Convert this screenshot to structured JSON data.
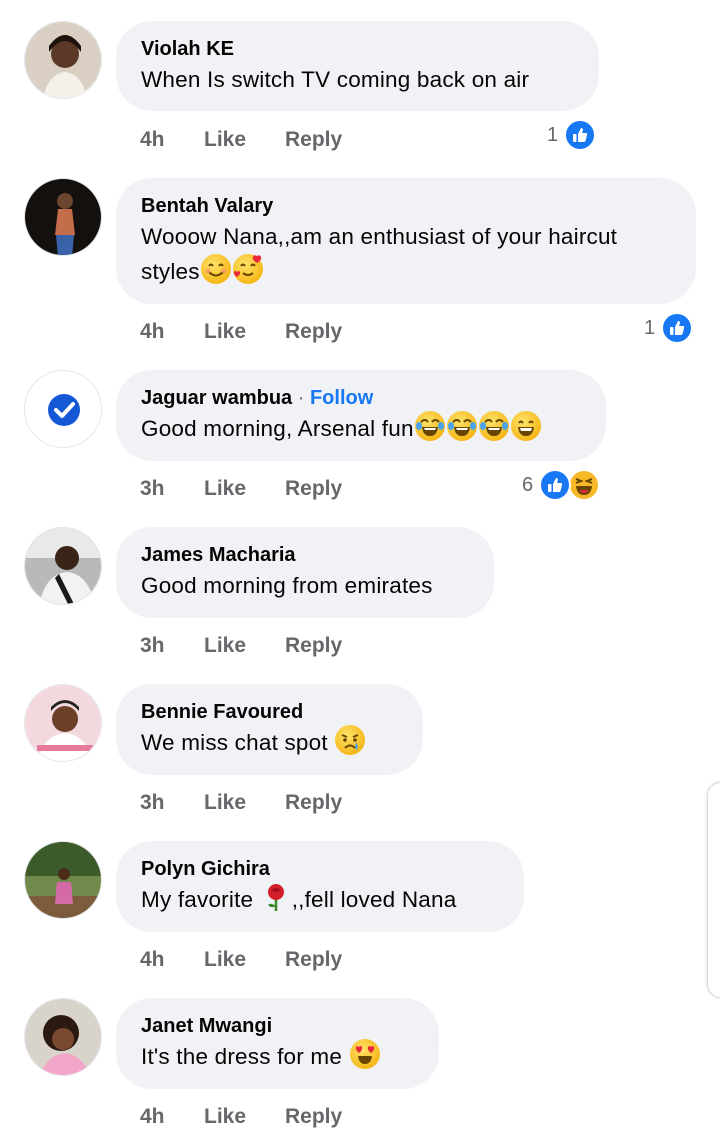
{
  "comments": [
    {
      "name": "Violah KE",
      "text": "When Is switch TV coming back on air",
      "time": "4h",
      "like": "Like",
      "reply": "Reply",
      "reaction_count": "1",
      "reactions": [
        "like-icon"
      ]
    },
    {
      "name": "Bentah Valary",
      "text_line1": "Wooow Nana,,am an enthusiast of your haircut",
      "text_line2": "styles",
      "time": "4h",
      "like": "Like",
      "reply": "Reply",
      "reaction_count": "1",
      "reactions": [
        "like-icon"
      ],
      "emojis": [
        "smiling-face-emoji",
        "smiling-face-with-hearts-emoji"
      ]
    },
    {
      "name": "Jaguar wambua",
      "separator": "·",
      "follow": "Follow",
      "text": "Good morning, Arsenal fun",
      "time": "3h",
      "like": "Like",
      "reply": "Reply",
      "reaction_count": "6",
      "reactions": [
        "like-icon",
        "haha-icon"
      ],
      "emojis": [
        "tears-of-joy-emoji",
        "tears-of-joy-emoji",
        "tears-of-joy-emoji",
        "grinning-face-emoji"
      ]
    },
    {
      "name": "James Macharia",
      "text": "Good morning from emirates",
      "time": "3h",
      "like": "Like",
      "reply": "Reply"
    },
    {
      "name": "Bennie Favoured",
      "text": "We miss chat spot",
      "time": "3h",
      "like": "Like",
      "reply": "Reply",
      "emojis": [
        "crying-face-emoji"
      ]
    },
    {
      "name": "Polyn Gichira",
      "text_a": "My favorite",
      "text_b": ",,fell loved Nana",
      "time": "4h",
      "like": "Like",
      "reply": "Reply",
      "emojis": [
        "rose-emoji"
      ]
    },
    {
      "name": "Janet Mwangi",
      "text": "It's the dress for me",
      "time": "4h",
      "like": "Like",
      "reply": "Reply",
      "emojis": [
        "heart-eyes-emoji"
      ]
    }
  ],
  "colors": {
    "bubble": "#f0f2f5",
    "meta": "#65676b",
    "link": "#1877f2",
    "text": "#050505"
  }
}
